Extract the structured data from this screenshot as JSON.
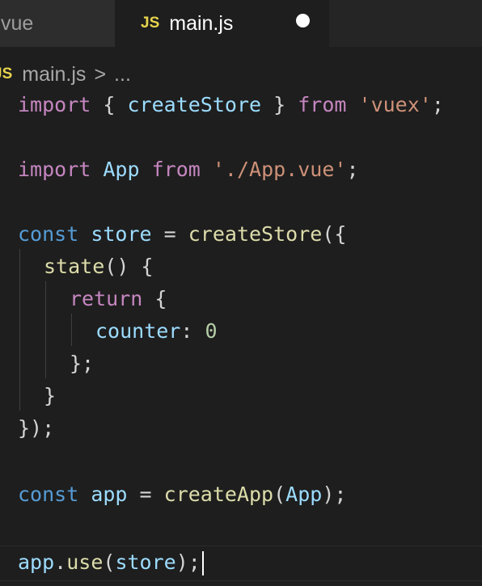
{
  "tabs": [
    {
      "label": ".vue",
      "active": false
    },
    {
      "badge": "JS",
      "label": "main.js",
      "active": true,
      "unsaved": true
    }
  ],
  "breadcrumb": {
    "badge": "JS",
    "file": "main.js",
    "separator": ">",
    "more": "..."
  },
  "code": {
    "l1": {
      "kw": "import",
      "p1": "{ ",
      "id": "createStore",
      "p2": " }",
      "from": "from",
      "str": "'vuex'",
      "end": ";"
    },
    "l2": {
      "kw": "import",
      "id": "App",
      "from": "from",
      "str": "'./App.vue'",
      "end": ";"
    },
    "l3": {
      "kw": "const",
      "id": "store",
      "op": " = ",
      "fn": "createStore",
      "p": "({"
    },
    "l4": {
      "fn": "state",
      "p": "() {"
    },
    "l5": {
      "kw": "return",
      "p": " {"
    },
    "l6": {
      "prop": "counter",
      "p": ": ",
      "num": "0"
    },
    "l7": {
      "p": "};"
    },
    "l8": {
      "p": "}"
    },
    "l9": {
      "p": "});"
    },
    "l10": {
      "kw": "const",
      "id": "app",
      "op": " = ",
      "fn": "createApp",
      "p1": "(",
      "arg": "App",
      "p2": ");"
    },
    "l11": {
      "obj": "app",
      "dot": ".",
      "fn": "use",
      "p1": "(",
      "arg": "store",
      "p2": ");"
    }
  },
  "colors": {
    "background": "#1e1e1e",
    "keyword_import": "#c586c0",
    "keyword_decl": "#569cd6",
    "identifier": "#9cdcfe",
    "function": "#dcdcaa",
    "string": "#ce9178",
    "number": "#b5cea8",
    "js_badge": "#e8d44d"
  }
}
